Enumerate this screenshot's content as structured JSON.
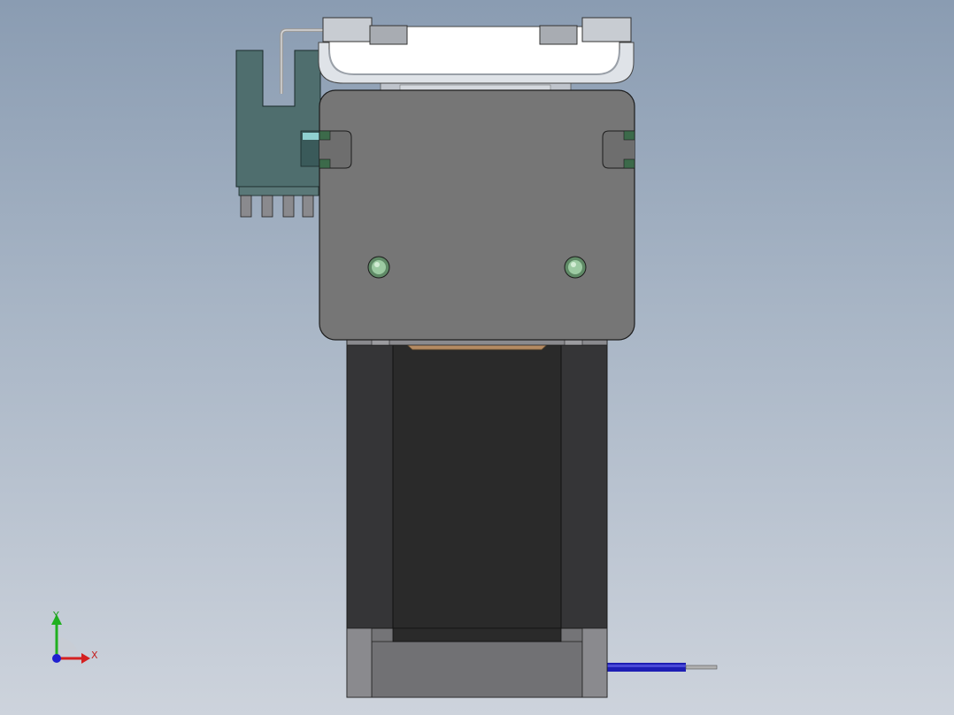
{
  "viewport": {
    "background_top": "#8a9cb2",
    "background_bottom": "#cdd3dc"
  },
  "model": {
    "parts": [
      "pump-head-cover",
      "pump-mounting-plate",
      "optical-sensor-bracket",
      "stepper-motor-body",
      "motor-cable"
    ],
    "colors": {
      "plate": "#767676",
      "cover": "#ffffff",
      "sensor": "#4f6e6e",
      "motor_dark": "#2a2a2a",
      "motor_side": "#3a3a3c",
      "motor_end": "#747477",
      "screw": "#7fae86",
      "cable": "#1e1eb4",
      "gasket": "#b48a62"
    }
  },
  "triad": {
    "x_label": "X",
    "y_label": "Y",
    "x_color": "#d42020",
    "y_color": "#20b020",
    "z_color": "#2020d0"
  }
}
